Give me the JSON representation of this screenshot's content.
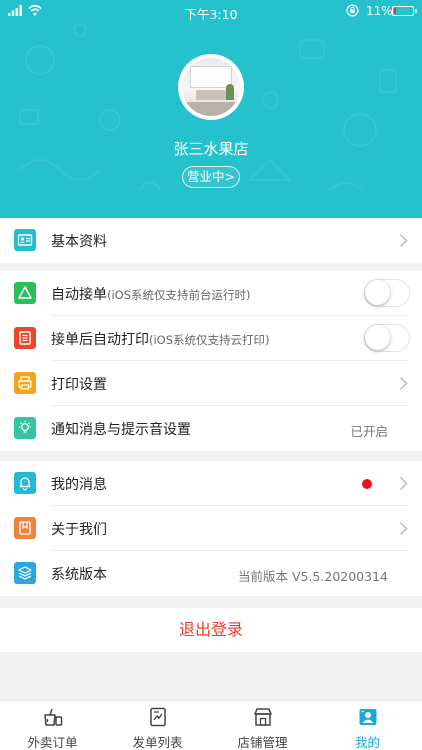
{
  "status_bar": {
    "time": "下午3:10",
    "battery_percent": "11%",
    "battery_level": 0.11
  },
  "profile": {
    "shop_name": "张三水果店",
    "status_badge": "营业中>"
  },
  "menu": {
    "basic_info": {
      "label": "基本资料"
    },
    "auto_accept": {
      "label": "自动接单",
      "note": "(iOS系统仅支持前台运行时)",
      "enabled": false
    },
    "auto_print": {
      "label": "接单后自动打印",
      "note": "(iOS系统仅支持云打印)",
      "enabled": false
    },
    "print_settings": {
      "label": "打印设置"
    },
    "notification": {
      "label": "通知消息与提示音设置",
      "value": "已开启"
    },
    "my_messages": {
      "label": "我的消息",
      "has_unread": true
    },
    "about_us": {
      "label": "关于我们"
    },
    "system_version": {
      "label": "系统版本",
      "value": "当前版本 V5.5.20200314"
    }
  },
  "logout_label": "退出登录",
  "tabs": [
    {
      "label": "外卖订单",
      "icon": "takeout-icon",
      "active": false
    },
    {
      "label": "发单列表",
      "icon": "list-icon",
      "active": false
    },
    {
      "label": "店铺管理",
      "icon": "store-icon",
      "active": false
    },
    {
      "label": "我的",
      "icon": "profile-icon",
      "active": true
    }
  ],
  "colors": {
    "header_bg": "#25c1cc",
    "logout_text": "#e2412c",
    "tab_active": "#1aa9d6",
    "unread_dot": "#e5141b"
  }
}
